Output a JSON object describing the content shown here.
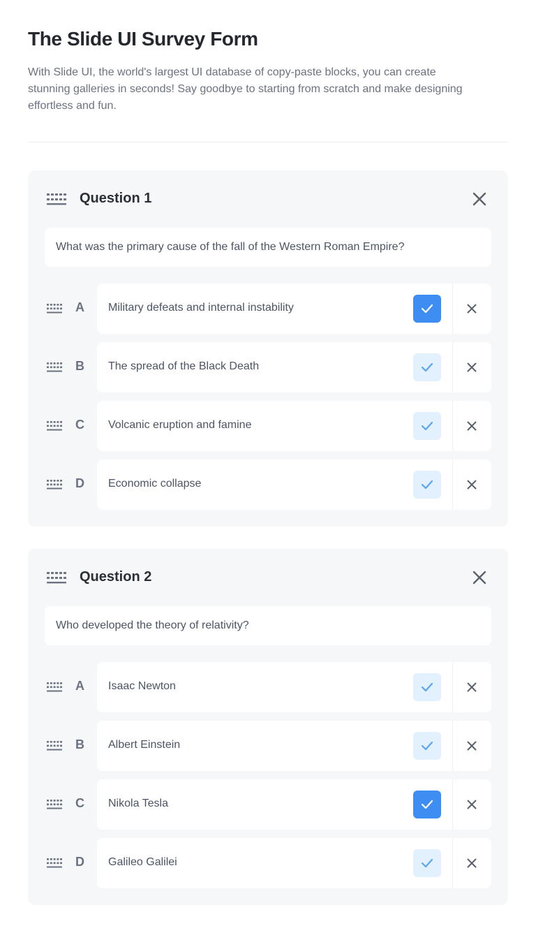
{
  "header": {
    "title": "The Slide UI Survey Form",
    "description": "With Slide UI, the world's largest UI database of copy-paste blocks, you can create stunning galleries in seconds! Say goodbye to starting from scratch and make designing effortless and fun."
  },
  "colors": {
    "accent": "#3d8df2",
    "accent_light": "#e3f0fd",
    "card_bg": "#f6f7f9"
  },
  "icons": {
    "drag": "drag-handle-icon",
    "remove": "close-icon",
    "check": "check-icon"
  },
  "questions": [
    {
      "title": "Question 1",
      "text": "What was the primary cause of the fall of the Western Roman Empire?",
      "answers": [
        {
          "letter": "A",
          "text": "Military defeats and internal instability",
          "selected": true
        },
        {
          "letter": "B",
          "text": "The spread of the Black Death",
          "selected": false
        },
        {
          "letter": "C",
          "text": "Volcanic eruption and famine",
          "selected": false
        },
        {
          "letter": "D",
          "text": "Economic collapse",
          "selected": false
        }
      ]
    },
    {
      "title": "Question 2",
      "text": "Who developed the theory of relativity?",
      "answers": [
        {
          "letter": "A",
          "text": "Isaac Newton",
          "selected": false
        },
        {
          "letter": "B",
          "text": "Albert Einstein",
          "selected": false
        },
        {
          "letter": "C",
          "text": "Nikola Tesla",
          "selected": true
        },
        {
          "letter": "D",
          "text": "Galileo Galilei",
          "selected": false
        }
      ]
    }
  ]
}
